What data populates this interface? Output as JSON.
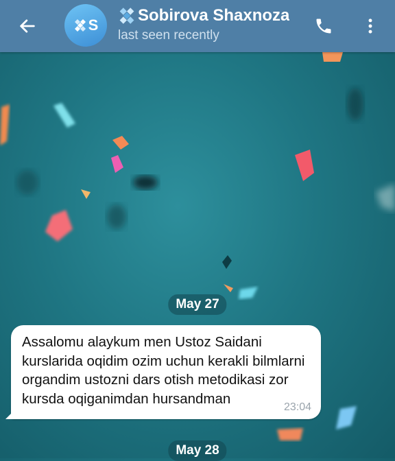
{
  "header": {
    "contact_name": "Sobirova Shaxnoza",
    "status": "last seen recently",
    "avatar_initial": "S"
  },
  "icons": {
    "back": "arrow-left-icon",
    "call": "phone-icon",
    "menu": "more-vertical-icon",
    "name_badge": "diamond-cluster-icon"
  },
  "colors": {
    "header_bg": "#4f7fa6",
    "avatar_bg": "#4aa3e6",
    "badge": "#7ec4f0",
    "bubble_bg": "#ffffff",
    "wallpaper": "#1f7683"
  },
  "messages": [
    {
      "date": "May 27",
      "text": "Assalomu alaykum  men Ustoz  Saidani kurslarida oqidim ozim uchun kerakli bilmlarni organdim ustozni dars otish metodikasi zor kursda oqiganimdan hursandman",
      "time": "23:04"
    }
  ],
  "next_date": "May 28"
}
